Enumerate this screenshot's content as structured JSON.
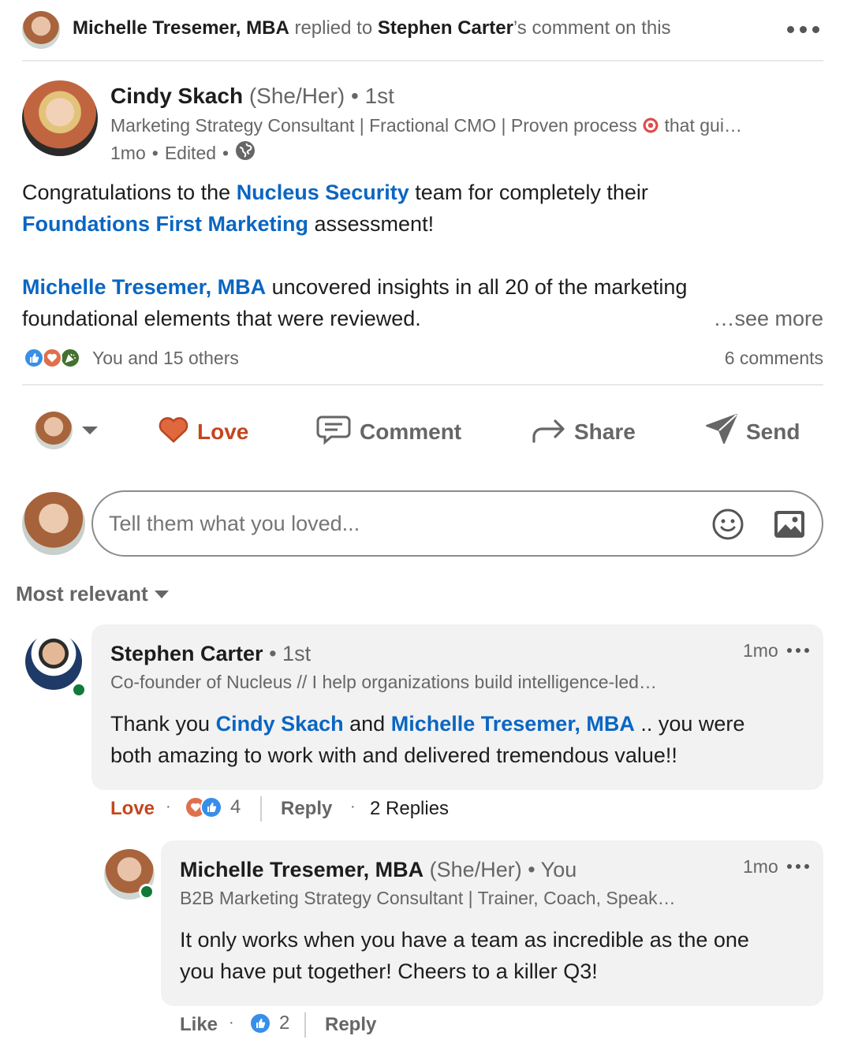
{
  "activity": {
    "actor": "Michelle Tresemer, MBA",
    "verb": " replied to ",
    "target": "Stephen Carter",
    "suffix": "’s comment on this"
  },
  "post": {
    "author_name": "Cindy Skach",
    "pronouns": "(She/Her)",
    "degree": "1st",
    "headline": "Marketing Strategy Consultant | Fractional CMO | Proven process",
    "headline_tail": "that gui…",
    "time": "1mo",
    "edited": "Edited",
    "body": {
      "p1_a": "Congratulations to the ",
      "p1_link1": "Nucleus Security",
      "p1_b": " team for completely their",
      "p1_link2": "Foundations First Marketing",
      "p1_c": " assessment!",
      "p2_link": "Michelle Tresemer, MBA",
      "p2_a": " uncovered insights in all 20 of the marketing",
      "p2_b": "foundational elements that were reviewed."
    },
    "see_more": "…see more",
    "reactions_text": "You and 15 others",
    "comments_count": "6 comments"
  },
  "actions": {
    "love": "Love",
    "comment": "Comment",
    "share": "Share",
    "send": "Send"
  },
  "composer": {
    "placeholder": "Tell them what you loved..."
  },
  "sort": {
    "label": "Most relevant"
  },
  "comments": [
    {
      "name": "Stephen Carter",
      "degree": "1st",
      "headline": "Co-founder of Nucleus // I help organizations build intelligence-led…",
      "time": "1mo",
      "text_a": "Thank you ",
      "link1": "Cindy Skach",
      "text_b": " and ",
      "link2": "Michelle Tresemer, MBA",
      "text_c": " .. you were",
      "text_d": "both amazing to work with and delivered tremendous value!!",
      "reaction_label": "Love",
      "reaction_count": "4",
      "reply_label": "Reply",
      "replies_label": "2 Replies"
    },
    {
      "name": "Michelle Tresemer, MBA",
      "pronouns": "(She/Her)",
      "degree": "You",
      "headline": "B2B Marketing Strategy Consultant | Trainer, Coach, Speak…",
      "time": "1mo",
      "text_a": "It only works when you have a team as incredible as the one",
      "text_b": "you have put together! Cheers to a killer Q3!",
      "reaction_label": "Like",
      "reaction_count": "2",
      "reply_label": "Reply"
    }
  ],
  "colors": {
    "link": "#0a66c2",
    "love": "#c4461e",
    "love_fill": "#e0683f",
    "online": "#107a3a",
    "like_blue": "#378fe9"
  }
}
